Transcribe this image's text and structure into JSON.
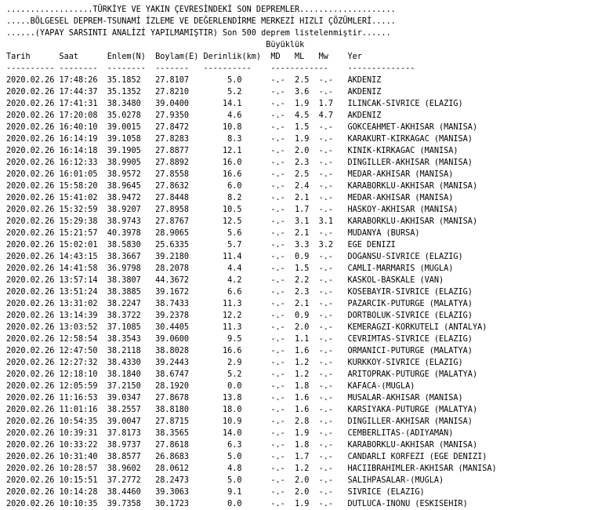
{
  "header": {
    "title_line": "..................TÜRKİYE VE YAKIN ÇEVRESİNDEKİ SON DEPREMLER....................",
    "subtitle_line": ".....BÖLGESEL DEPREM-TSUNAMİ İZLEME VE DEĞERLENDİRME MERKEZİ HIZLI ÇÖZÜMLERİ.....",
    "note_line": "......(YAPAY SARSINTI ANALİZİ YAPILMAMIŞTIR) Son 500 deprem listelenmiştir......",
    "magnitude_group_line": "                                                      Büyüklük",
    "column_header_line": "Tarih      Saat      Enlem(N)  Boylam(E) Derinlik(km)  MD   ML   Mw    Yer",
    "separator_line": "---------- --------  --------  -------   ----------    ------------    --------------"
  },
  "rows": [
    {
      "line": "2020.02.26 17:48:26  35.1852   27.8107        5.0      -.-  2.5  -.-   AKDENIZ"
    },
    {
      "line": "2020.02.26 17:44:37  35.1352   27.8210        5.2      -.-  3.6  -.-   AKDENIZ"
    },
    {
      "line": "2020.02.26 17:41:31  38.3480   39.0400       14.1      -.-  1.9  1.7   ILINCAK-SIVRICE (ELAZIG)"
    },
    {
      "line": "2020.02.26 17:20:08  35.0278   27.9350        4.6      -.-  4.5  4.7   AKDENIZ"
    },
    {
      "line": "2020.02.26 16:40:10  39.0015   27.8472       10.8      -.-  1.5  -.-   GOKCEAHMET-AKHISAR (MANISA)"
    },
    {
      "line": "2020.02.26 16:14:19  39.1058   27.8283        8.3      -.-  1.9  -.-   KARAKURT-KIRKAGAC (MANISA)"
    },
    {
      "line": "2020.02.26 16:14:18  39.1905   27.8877       12.1      -.-  2.0  -.-   KINIK-KIRKAGAC (MANISA)"
    },
    {
      "line": "2020.02.26 16:12:33  38.9905   27.8892       16.0      -.-  2.3  -.-   DINGILLER-AKHISAR (MANISA)"
    },
    {
      "line": "2020.02.26 16:01:05  38.9572   27.8558       16.6      -.-  2.5  -.-   MEDAR-AKHISAR (MANISA)"
    },
    {
      "line": "2020.02.26 15:58:20  38.9645   27.8632        6.0      -.-  2.4  -.-   KARABORKLU-AKHISAR (MANISA)"
    },
    {
      "line": "2020.02.26 15:41:02  38.9472   27.8448        8.2      -.-  2.1  -.-   MEDAR-AKHISAR (MANISA)"
    },
    {
      "line": "2020.02.26 15:32:59  38.9207   27.8958       10.5      -.-  1.7  -.-   HASKOY-AKHISAR (MANISA)"
    },
    {
      "line": "2020.02.26 15:29:38  38.9743   27.8767       12.5      -.-  3.1  3.1   KARABORKLU-AKHISAR (MANISA)"
    },
    {
      "line": "2020.02.26 15:21:57  40.3978   28.9065        5.6      -.-  2.1  -.-   MUDANYA (BURSA)"
    },
    {
      "line": "2020.02.26 15:02:01  38.5830   25.6335        5.7      -.-  3.3  3.2   EGE DENIZI"
    },
    {
      "line": "2020.02.26 14:43:15  38.3667   39.2180       11.4      -.-  0.9  -.-   DOGANSU-SIVRICE (ELAZIG)"
    },
    {
      "line": "2020.02.26 14:41:58  36.9798   28.2078        4.4      -.-  1.5  -.-   CAMLI-MARMARIS (MUGLA)"
    },
    {
      "line": "2020.02.26 13:57:14  38.3807   44.3672        4.2      -.-  2.2  -.-   KASKOL-BASKALE (VAN)"
    },
    {
      "line": "2020.02.26 13:51:24  38.3885   39.1672        6.6      -.-  2.3  -.-   KOSEBAYIR-SIVRICE (ELAZIG)"
    },
    {
      "line": "2020.02.26 13:31:02  38.2247   38.7433       11.3      -.-  2.1  -.-   PAZARCIK-PUTURGE (MALATYA)"
    },
    {
      "line": "2020.02.26 13:14:39  38.3722   39.2378       12.2      -.-  0.9  -.-   DORTBOLUK-SIVRICE (ELAZIG)"
    },
    {
      "line": "2020.02.26 13:03:52  37.1085   30.4405       11.3      -.-  2.0  -.-   KEMERAGZI-KORKUTELI (ANTALYA)"
    },
    {
      "line": "2020.02.26 12:58:54  38.3543   39.0600        9.5      -.-  1.1  -.-   CEVRIMTAS-SIVRICE (ELAZIG)"
    },
    {
      "line": "2020.02.26 12:47:50  38.2118   38.8028       16.6      -.-  1.6  -.-   ORMANICI-PUTURGE (MALATYA)"
    },
    {
      "line": "2020.02.26 12:27:32  38.4330   39.2443        2.9      -.-  1.2  -.-   KURKKOY-SIVRICE (ELAZIG)"
    },
    {
      "line": "2020.02.26 12:18:10  38.1840   38.6747        5.2      -.-  1.2  -.-   ARITOPRAK-PUTURGE (MALATYA)"
    },
    {
      "line": "2020.02.26 12:05:59  37.2150   28.1920        0.0      -.-  1.8  -.-   KAFACA-(MUGLA)"
    },
    {
      "line": "2020.02.26 11:16:53  39.0347   27.8678       13.8      -.-  1.6  -.-   MUSALAR-AKHISAR (MANISA)"
    },
    {
      "line": "2020.02.26 11:01:16  38.2557   38.8180       18.0      -.-  1.6  -.-   KARSIYAKA-PUTURGE (MALATYA)"
    },
    {
      "line": "2020.02.26 10:54:35  39.0047   27.8715       10.9      -.-  2.8  -.-   DINGILLER-AKHISAR (MANISA)"
    },
    {
      "line": "2020.02.26 10:39:31  37.8173   38.3565       14.0      -.-  1.9  -.-   CEMBERLITAS-(ADIYAMAN)"
    },
    {
      "line": "2020.02.26 10:33:22  38.9737   27.8618        6.3      -.-  1.8  -.-   KARABORKLU-AKHISAR (MANISA)"
    },
    {
      "line": "2020.02.26 10:31:40  38.8577   26.8683        5.0      -.-  1.7  -.-   CANDARLI KORFEZI (EGE DENIZI)"
    },
    {
      "line": "2020.02.26 10:28:57  38.9602   28.0612        4.8      -.-  1.2  -.-   HACIIBRAHIMLER-AKHISAR (MANISA)"
    },
    {
      "line": "2020.02.26 10:15:51  37.2772   28.2473        5.0      -.-  2.0  -.-   SALIHPASALAR-(MUGLA)"
    },
    {
      "line": "2020.02.26 10:14:28  38.4460   39.3063        9.1      -.-  2.0  -.-   SIVRICE (ELAZIG)"
    },
    {
      "line": "2020.02.26 10:10:35  39.7358   30.1723        0.0      -.-  1.9  -.-   DUTLUCA-INONU (ESKISEHIR)"
    }
  ]
}
